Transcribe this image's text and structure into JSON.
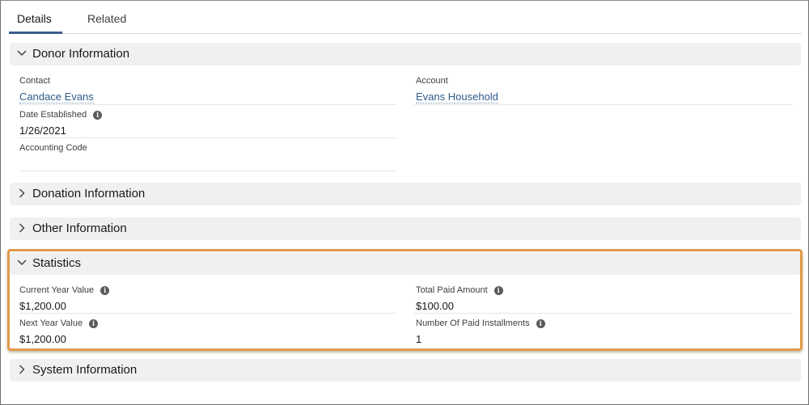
{
  "tabs": [
    {
      "label": "Details",
      "active": true
    },
    {
      "label": "Related",
      "active": false
    }
  ],
  "sections": {
    "donor": {
      "title": "Donor Information",
      "expanded": true,
      "fields": {
        "contact": {
          "label": "Contact",
          "value": "Candace Evans"
        },
        "account": {
          "label": "Account",
          "value": "Evans Household"
        },
        "date_established": {
          "label": "Date Established",
          "value": "1/26/2021"
        },
        "accounting_code": {
          "label": "Accounting Code",
          "value": ""
        }
      }
    },
    "donation": {
      "title": "Donation Information",
      "expanded": false
    },
    "other": {
      "title": "Other Information",
      "expanded": false
    },
    "statistics": {
      "title": "Statistics",
      "expanded": true,
      "fields": {
        "current_year_value": {
          "label": "Current Year Value",
          "value": "$1,200.00"
        },
        "total_paid_amount": {
          "label": "Total Paid Amount",
          "value": "$100.00"
        },
        "next_year_value": {
          "label": "Next Year Value",
          "value": "$1,200.00"
        },
        "number_of_paid_installments": {
          "label": "Number Of Paid Installments",
          "value": "1"
        }
      }
    },
    "system": {
      "title": "System Information",
      "expanded": false
    }
  },
  "icons": {
    "info": "i",
    "chevron_down": "chevron-down",
    "chevron_right": "chevron-right"
  },
  "colors": {
    "link": "#2e5c8a",
    "tab_active_underline": "#3a5f8a",
    "highlight_border": "#e09a4a",
    "section_header_bg": "#f0f0f0"
  }
}
